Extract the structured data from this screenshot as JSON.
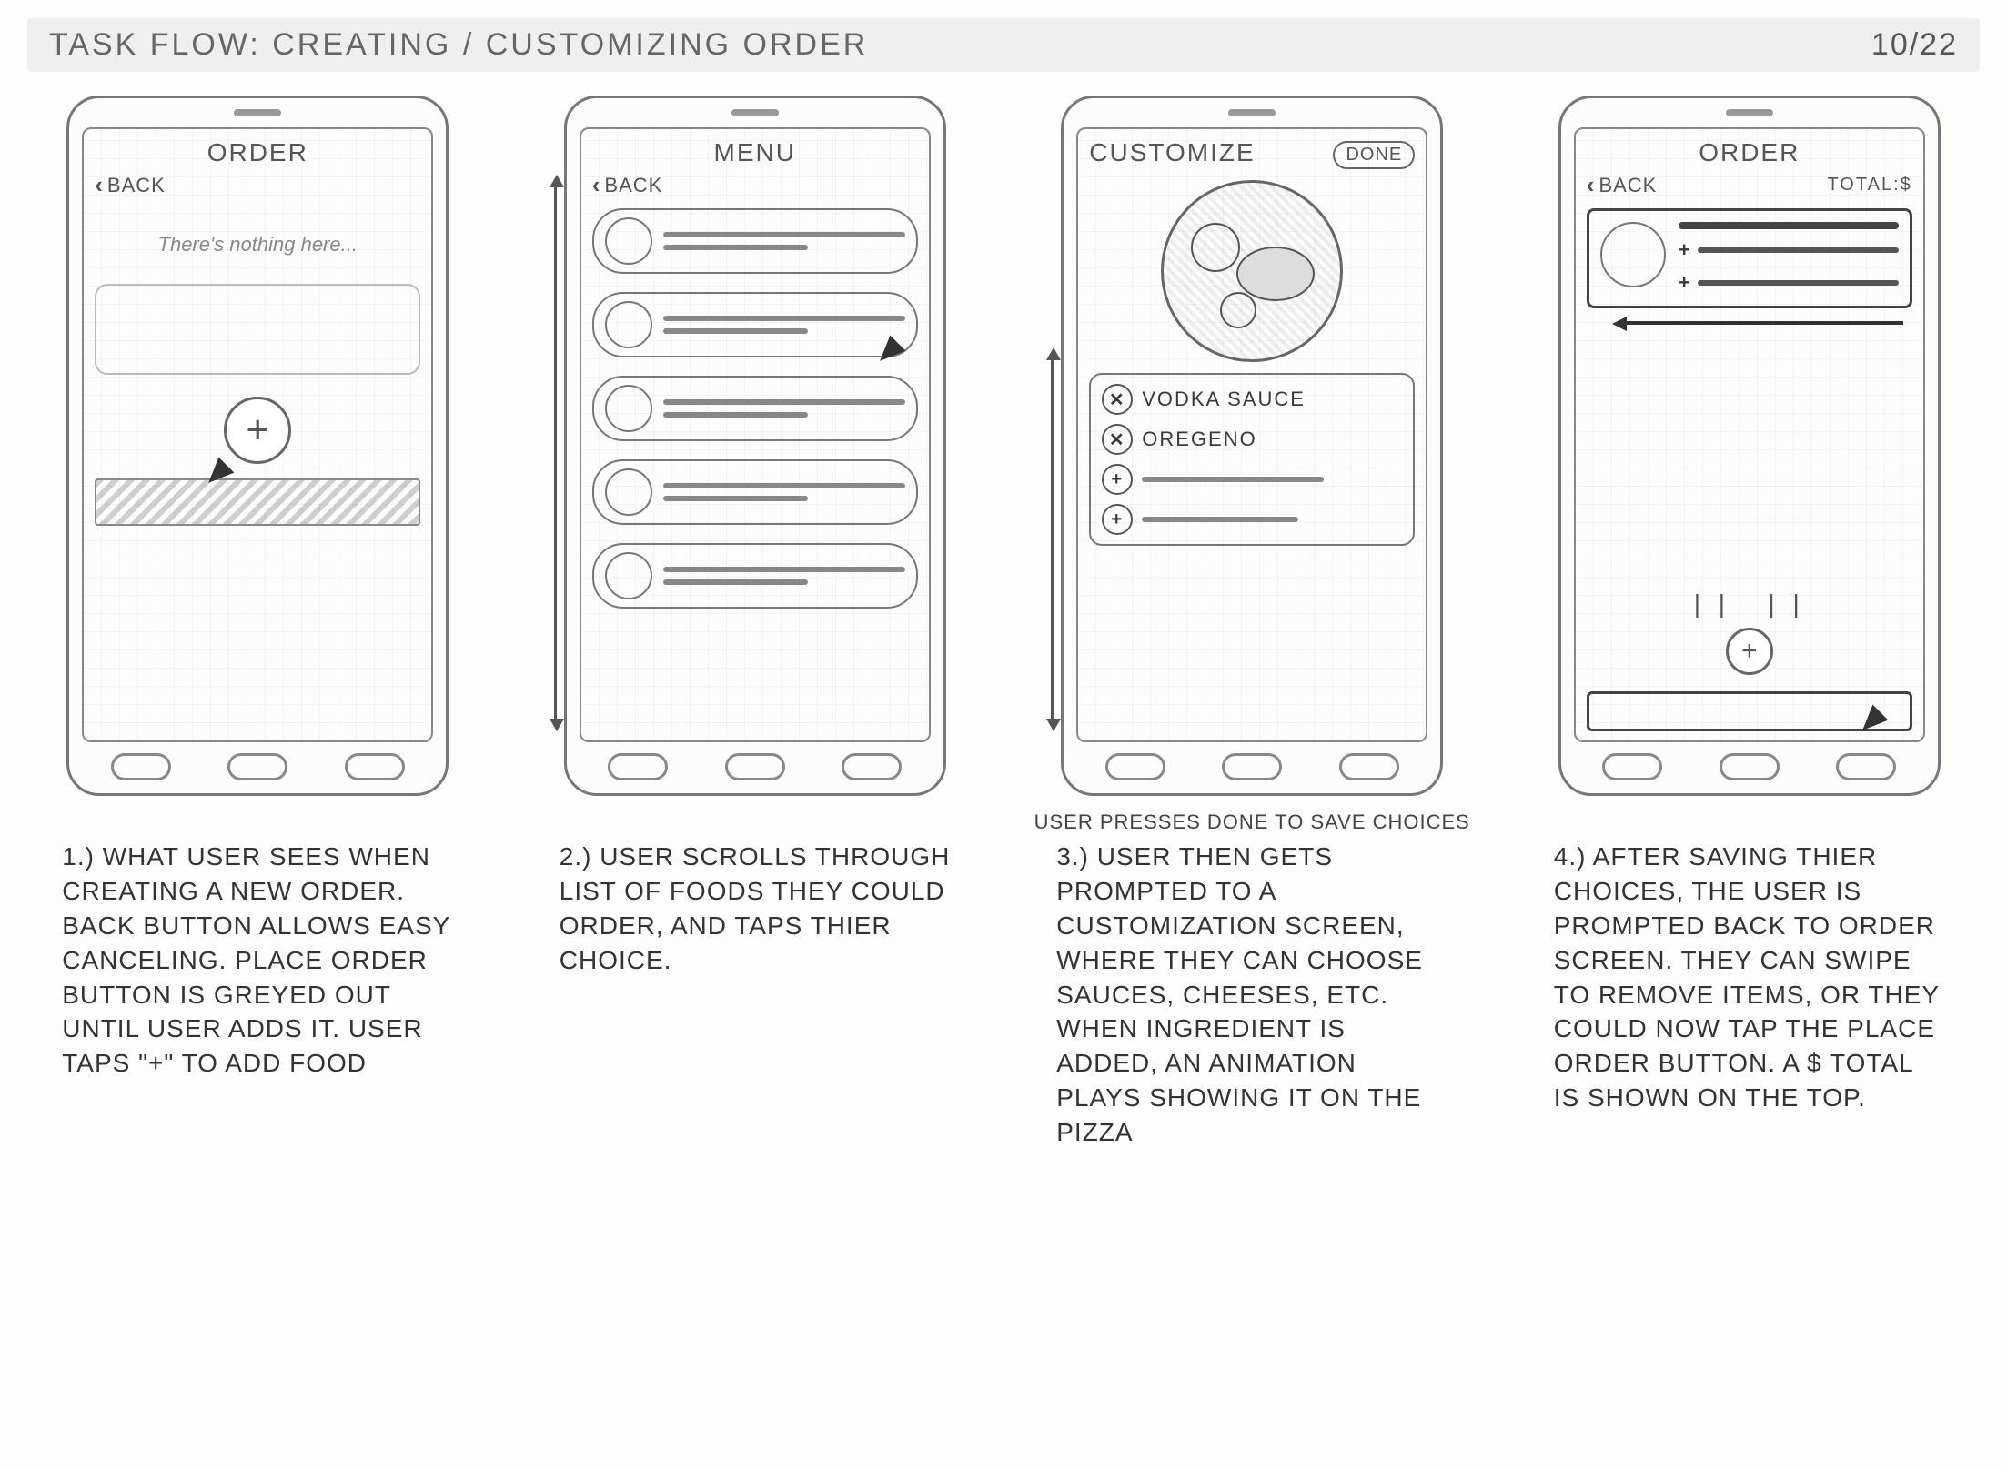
{
  "header": {
    "title": "TASK FLOW: CREATING / CUSTOMIZING ORDER",
    "date": "10/22"
  },
  "steps": [
    {
      "screen": {
        "kind": "order-empty",
        "title": "ORDER",
        "back_label": "BACK",
        "empty_text": "There's nothing\nhere...",
        "add_label": "+"
      },
      "pre_caption": "",
      "caption": "1.) What user sees when creating a new order. Back button allows easy canceling. Place order button is greyed out until user adds it. User taps \"+\" to add food"
    },
    {
      "screen": {
        "kind": "menu",
        "title": "MENU",
        "back_label": "BACK",
        "item_count": 5
      },
      "pre_caption": "",
      "caption": "2.) User scrolls through list of foods they could order, and taps thier choice."
    },
    {
      "screen": {
        "kind": "customize",
        "title": "CUSTOMIZE",
        "done_label": "DONE",
        "ingredients_selected": [
          "VODKA SAUCE",
          "OREGENO"
        ],
        "ingredients_available_count": 2
      },
      "pre_caption": "User presses done to save choices",
      "caption": "3.) User then gets prompted to a customization screen, where they can choose sauces, cheeses, etc. When ingredient is added, an animation plays showing it on the pizza"
    },
    {
      "screen": {
        "kind": "order-filled",
        "title": "ORDER",
        "back_label": "BACK",
        "total_label": "TOTAL:$",
        "add_label": "+"
      },
      "pre_caption": "",
      "caption": "4.) After saving thier choices, the user is prompted back to order screen. They can swipe to remove items, or they could now tap the place order button. A $ total is shown on the top."
    }
  ]
}
